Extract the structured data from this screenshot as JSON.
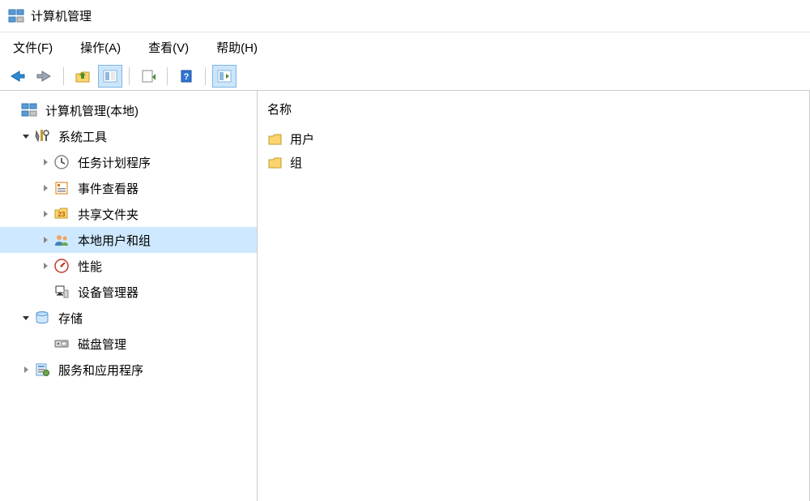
{
  "window": {
    "title": "计算机管理"
  },
  "menu": {
    "file": "文件(F)",
    "action": "操作(A)",
    "view": "查看(V)",
    "help": "帮助(H)"
  },
  "tree": {
    "root": "计算机管理(本地)",
    "system_tools": "系统工具",
    "task_scheduler": "任务计划程序",
    "event_viewer": "事件查看器",
    "shared_folders": "共享文件夹",
    "local_users_groups": "本地用户和组",
    "performance": "性能",
    "device_manager": "设备管理器",
    "storage": "存储",
    "disk_management": "磁盘管理",
    "services_apps": "服务和应用程序"
  },
  "list": {
    "column_name": "名称",
    "items": {
      "users": "用户",
      "groups": "组"
    }
  }
}
